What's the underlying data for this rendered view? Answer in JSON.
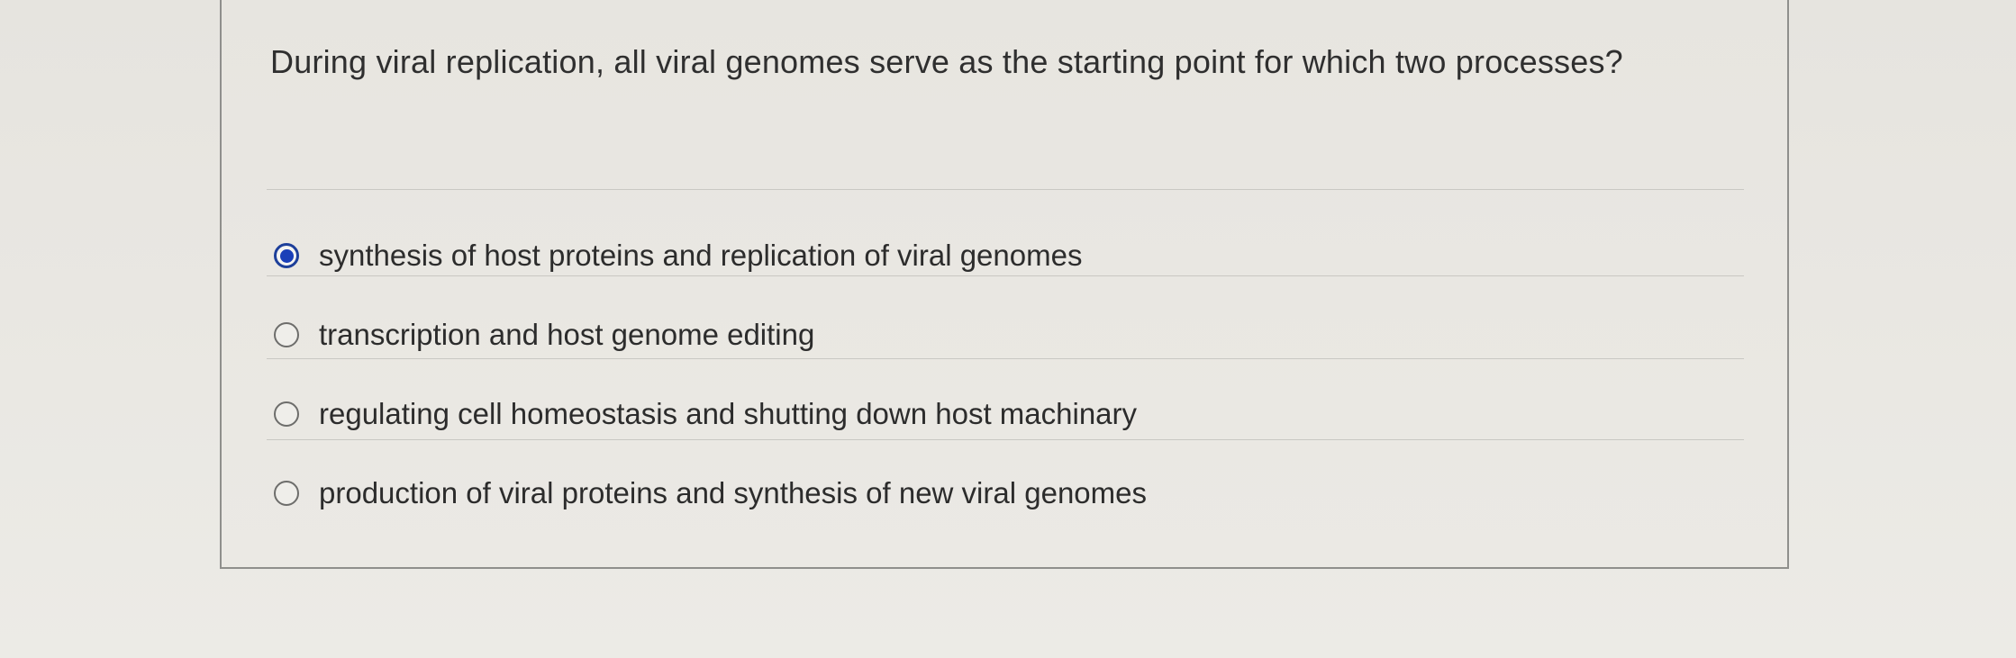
{
  "question": {
    "text": "During viral replication, all viral genomes serve as the starting point for which two processes?"
  },
  "options": [
    {
      "label": "synthesis of host proteins and replication of viral genomes",
      "selected": true
    },
    {
      "label": "transcription and host genome editing",
      "selected": false
    },
    {
      "label": "regulating cell homeostasis and shutting down host machinary",
      "selected": false
    },
    {
      "label": "production of viral proteins and synthesis of new viral genomes",
      "selected": false
    }
  ],
  "colors": {
    "selected_radio": "#1a3fb8",
    "background": "#e8e6e1"
  }
}
